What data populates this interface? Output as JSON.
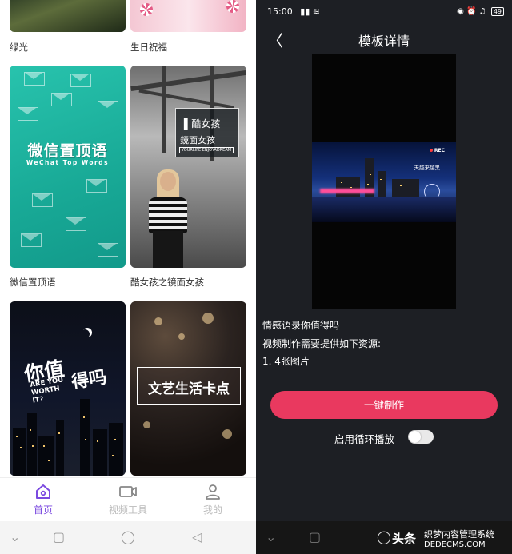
{
  "left": {
    "templates": [
      {
        "label": "绿光"
      },
      {
        "label": "生日祝福"
      },
      {
        "label": "微信置顶语",
        "thumb_title": "微信置顶语",
        "thumb_sub": "WeChat Top Words"
      },
      {
        "label": "酷女孩之镜面女孩",
        "thumb_t1": "▌酷女孩",
        "thumb_t2": "鏡面女孩",
        "thumb_t3": "YOURLIFE ENJOYADREAM"
      },
      {
        "label": "",
        "thumb_t1": "你值",
        "thumb_t2": "ARE YOU WORTH IT?",
        "thumb_t3": "得吗"
      },
      {
        "label": "",
        "thumb_title": "文艺生活卡点"
      }
    ],
    "tabs": [
      {
        "label": "首页",
        "icon": "home-icon",
        "active": true
      },
      {
        "label": "视频工具",
        "icon": "video-tool-icon",
        "active": false
      },
      {
        "label": "我的",
        "icon": "profile-icon",
        "active": false
      }
    ],
    "accent": "#7b4ae0"
  },
  "right": {
    "status_time": "15:00",
    "status_icons": "◉ ⏰ ♫",
    "battery": "49",
    "back": "〈",
    "title": "模板详情",
    "video": {
      "rec": "REC",
      "overlay_text": "天越来越黑"
    },
    "description": "情感语录你值得吗",
    "resources_heading": "视频制作需要提供如下资源:",
    "resource_item": "1. 4张图片",
    "create_button": "一键制作",
    "loop_label": "启用循环播放",
    "loop_enabled": false,
    "accent": "#e9395f"
  },
  "watermark": {
    "brand": "头条",
    "line1": "织梦内容管理系统",
    "line2": "DEDECMS.COM"
  }
}
